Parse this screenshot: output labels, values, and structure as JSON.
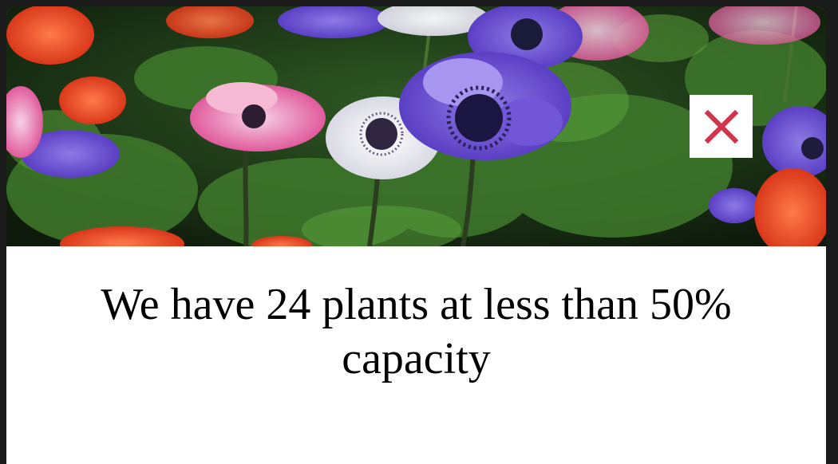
{
  "modal": {
    "headline": "We have 24 plants at less than 50% capacity",
    "close_button": {
      "icon": "close-icon",
      "color": "#d0344c"
    },
    "hero_image": {
      "subject": "anemone-flowers-photo"
    }
  }
}
